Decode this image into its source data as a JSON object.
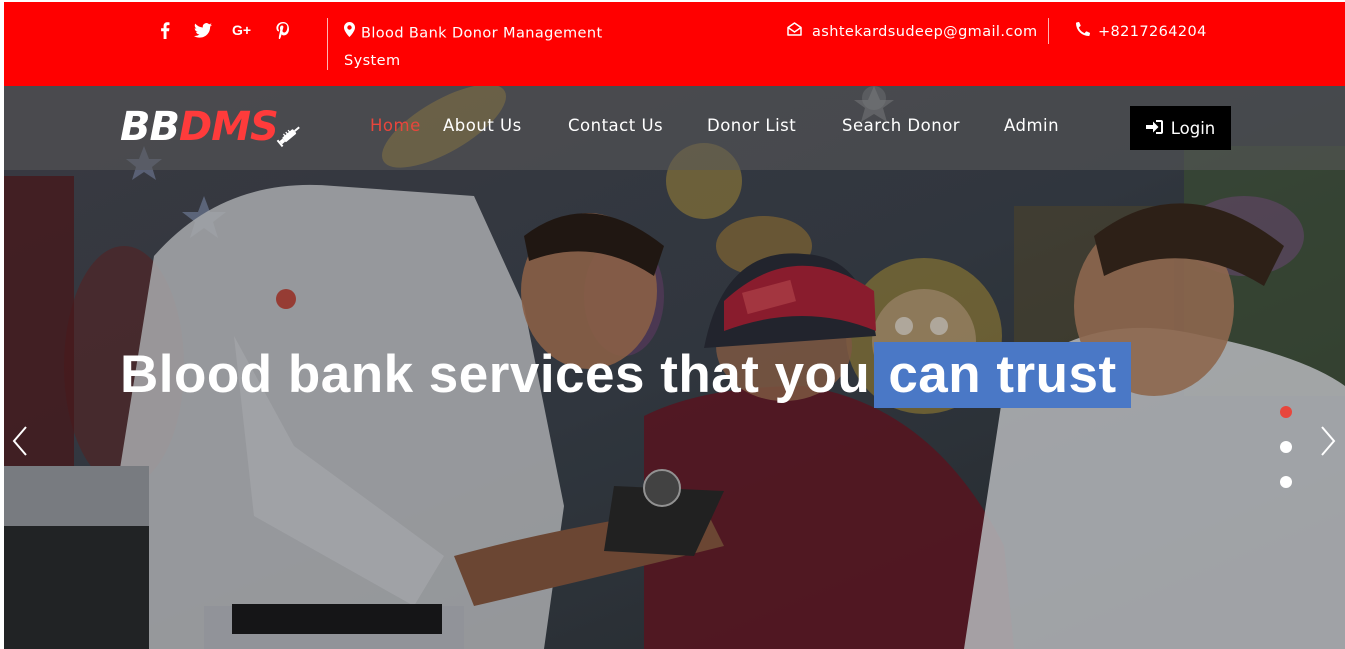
{
  "topbar": {
    "bg_color": "#ff0000",
    "social_icons": [
      "facebook-icon",
      "twitter-icon",
      "google-plus-icon",
      "pinterest-icon"
    ],
    "address_icon": "map-marker-icon",
    "address": "Blood Bank Donor Management System",
    "email_icon": "envelope-open-icon",
    "email": "ashtekardsudeep@gmail.com",
    "phone_icon": "phone-icon",
    "phone": "+8217264204"
  },
  "navbar": {
    "logo_part1": "BB",
    "logo_part2": "DMS",
    "logo_icon": "syringe-icon",
    "items": [
      {
        "label": "Home",
        "active": true
      },
      {
        "label": "About Us"
      },
      {
        "label": "Contact Us"
      },
      {
        "label": "Donor List"
      },
      {
        "label": "Search Donor"
      },
      {
        "label": "Admin"
      }
    ],
    "login_icon": "sign-in-icon",
    "login_label": "Login"
  },
  "hero": {
    "headline_main": "Blood bank services that you",
    "headline_highlight": "can trust",
    "highlight_color": "#4a78c6",
    "accent_color": "#e8463c",
    "slide_count": 3,
    "active_slide": 1,
    "prev_icon": "chevron-left-icon",
    "next_icon": "chevron-right-icon"
  }
}
